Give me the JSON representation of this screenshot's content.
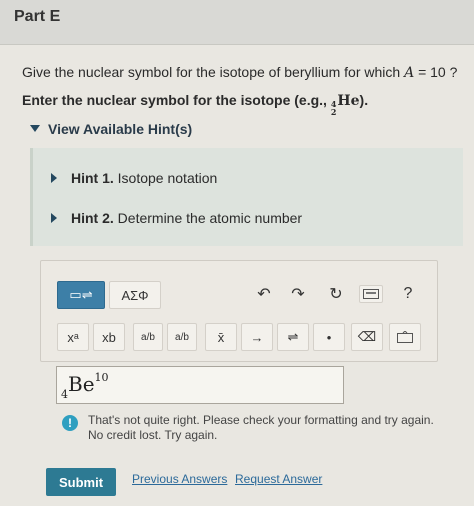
{
  "part": {
    "title": "Part E"
  },
  "question": {
    "prefix": "Give the nuclear symbol for the isotope of beryllium for which ",
    "var": "A",
    "eq": " = 10 ?"
  },
  "prompt": {
    "text": "Enter the nuclear symbol for the isotope (e.g., ",
    "example_mass": "4",
    "example_atomic": "2",
    "example_symbol": "He",
    "suffix": ")."
  },
  "hints": {
    "toggle_label": "View Available Hint(s)",
    "items": [
      {
        "number": "Hint 1.",
        "label": "Isotope notation"
      },
      {
        "number": "Hint 2.",
        "label": "Determine the atomic number"
      }
    ]
  },
  "toolbar": {
    "template_label": "▭⇌",
    "greek_label": "ΑΣΦ",
    "undo": "↶",
    "redo": "↷",
    "reset": "↻",
    "help": "?",
    "superscript": "xᵃ",
    "subscript": "xb",
    "fraction": "a/b",
    "mixed_fraction": "a/b",
    "vector_bar": "x̄",
    "arrow": "→",
    "equilibrium": "⇌",
    "dot": "•",
    "delete": "⌫"
  },
  "answer": {
    "atomic_number": "4",
    "symbol": "Be",
    "mass_number": "10"
  },
  "feedback": {
    "icon": "!",
    "line1": "That's not quite right. Please check your formatting and try again.",
    "line2": "No credit lost. Try again."
  },
  "actions": {
    "submit": "Submit",
    "previous_answers": "Previous Answers",
    "request_answer": "Request Answer"
  },
  "colors": {
    "accent": "#2d7a93",
    "link": "#2c6a9a",
    "info": "#2f9fc0"
  }
}
